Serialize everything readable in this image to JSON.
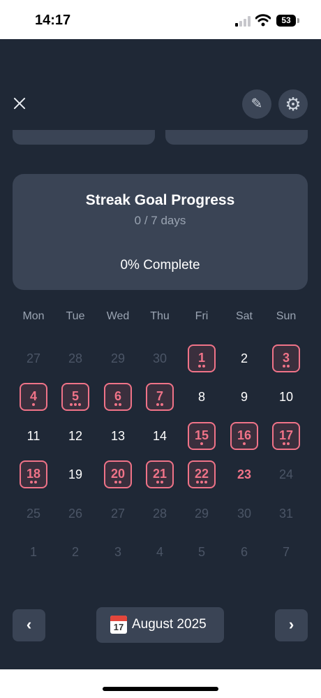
{
  "status_bar": {
    "time": "14:17",
    "battery": "53"
  },
  "toolbar": {
    "edit_icon": "✎",
    "settings_icon": "⚙"
  },
  "goal": {
    "title": "Streak Goal Progress",
    "subtitle": "0 / 7 days",
    "complete_label": "0% Complete",
    "progress_fraction": 0
  },
  "calendar": {
    "weekdays": [
      "Mon",
      "Tue",
      "Wed",
      "Thu",
      "Fri",
      "Sat",
      "Sun"
    ],
    "weeks": [
      [
        {
          "day": "27",
          "state": "muted"
        },
        {
          "day": "28",
          "state": "muted"
        },
        {
          "day": "29",
          "state": "muted"
        },
        {
          "day": "30",
          "state": "muted"
        },
        {
          "day": "1",
          "state": "streak",
          "dots": 2
        },
        {
          "day": "2",
          "state": "normal"
        },
        {
          "day": "3",
          "state": "streak",
          "dots": 2
        }
      ],
      [
        {
          "day": "4",
          "state": "streak",
          "dots": 1
        },
        {
          "day": "5",
          "state": "streak",
          "dots": 3
        },
        {
          "day": "6",
          "state": "streak",
          "dots": 2
        },
        {
          "day": "7",
          "state": "streak",
          "dots": 2
        },
        {
          "day": "8",
          "state": "normal"
        },
        {
          "day": "9",
          "state": "normal"
        },
        {
          "day": "10",
          "state": "normal"
        }
      ],
      [
        {
          "day": "11",
          "state": "normal"
        },
        {
          "day": "12",
          "state": "normal"
        },
        {
          "day": "13",
          "state": "normal"
        },
        {
          "day": "14",
          "state": "normal"
        },
        {
          "day": "15",
          "state": "streak",
          "dots": 1
        },
        {
          "day": "16",
          "state": "streak",
          "dots": 1
        },
        {
          "day": "17",
          "state": "streak",
          "dots": 2
        }
      ],
      [
        {
          "day": "18",
          "state": "streak",
          "dots": 2
        },
        {
          "day": "19",
          "state": "normal"
        },
        {
          "day": "20",
          "state": "streak",
          "dots": 2
        },
        {
          "day": "21",
          "state": "streak",
          "dots": 2
        },
        {
          "day": "22",
          "state": "streak",
          "dots": 3
        },
        {
          "day": "23",
          "state": "today"
        },
        {
          "day": "24",
          "state": "muted"
        }
      ],
      [
        {
          "day": "25",
          "state": "muted"
        },
        {
          "day": "26",
          "state": "muted"
        },
        {
          "day": "27",
          "state": "muted"
        },
        {
          "day": "28",
          "state": "muted"
        },
        {
          "day": "29",
          "state": "muted"
        },
        {
          "day": "30",
          "state": "muted"
        },
        {
          "day": "31",
          "state": "muted"
        }
      ],
      [
        {
          "day": "1",
          "state": "muted"
        },
        {
          "day": "2",
          "state": "muted"
        },
        {
          "day": "3",
          "state": "muted"
        },
        {
          "day": "4",
          "state": "muted"
        },
        {
          "day": "5",
          "state": "muted"
        },
        {
          "day": "6",
          "state": "muted"
        },
        {
          "day": "7",
          "state": "muted"
        }
      ]
    ]
  },
  "footer": {
    "prev_label": "‹",
    "next_label": "›",
    "calendar_icon_number": "17",
    "month_label": "August 2025"
  },
  "colors": {
    "background": "#1f2836",
    "card": "#3a4455",
    "accent": "#f07388",
    "muted_text": "#9aa4b2"
  }
}
